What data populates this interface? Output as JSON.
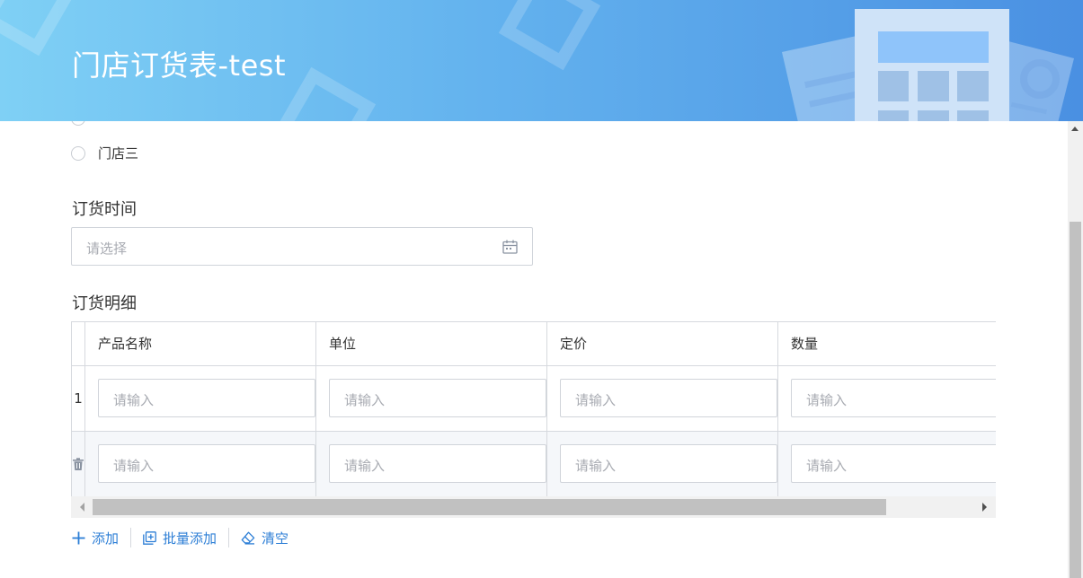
{
  "header": {
    "title": "门店订货表-test"
  },
  "stores": {
    "visible_option": "门店三"
  },
  "order_time": {
    "label": "订货时间",
    "placeholder": "请选择"
  },
  "order_detail": {
    "label": "订货明细",
    "columns": [
      "产品名称",
      "单位",
      "定价",
      "数量"
    ],
    "rows": [
      {
        "index": "1",
        "placeholders": [
          "请输入",
          "请输入",
          "请输入",
          "请输入"
        ]
      },
      {
        "index": "",
        "placeholders": [
          "请输入",
          "请输入",
          "请输入",
          "请输入"
        ]
      }
    ]
  },
  "actions": {
    "add": "添加",
    "batch_add": "批量添加",
    "clear": "清空"
  },
  "colors": {
    "accent": "#2c7ed6",
    "banner_start": "#7fd0f5",
    "banner_end": "#4a90e2"
  },
  "icons": {
    "date": "calendar-icon",
    "delete": "trash-icon",
    "add": "plus-icon",
    "batch": "batch-add-icon",
    "clear": "eraser-icon"
  }
}
